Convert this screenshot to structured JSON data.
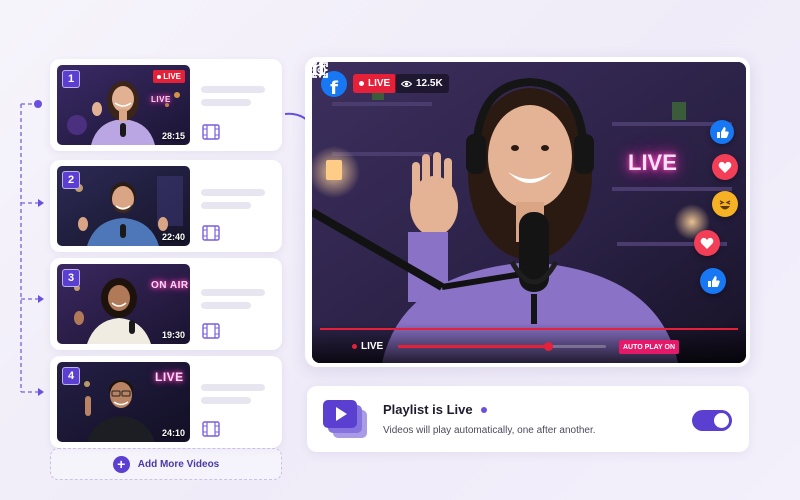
{
  "playlist": {
    "items": [
      {
        "number": "1",
        "duration": "28:15",
        "live_label": "LIVE",
        "sign": "LIVE",
        "is_live": true
      },
      {
        "number": "2",
        "duration": "22:40",
        "live_label": "",
        "sign": "",
        "is_live": false
      },
      {
        "number": "3",
        "duration": "19:30",
        "live_label": "",
        "sign": "ON AIR",
        "is_live": false
      },
      {
        "number": "4",
        "duration": "24:10",
        "live_label": "",
        "sign": "LIVE",
        "is_live": false
      }
    ],
    "add_more_label": "Add More Videos"
  },
  "player": {
    "platform_icon": "facebook-icon",
    "live_label": "LIVE",
    "viewer_count": "12.5K",
    "wall_sign": "LIVE",
    "controls": {
      "live_label": "LIVE",
      "autoplay_label": "AUTO PLAY ON",
      "progress": 0.72
    },
    "reactions": [
      "like-icon",
      "heart-icon",
      "haha-icon",
      "heart-icon",
      "like-icon"
    ]
  },
  "status": {
    "title": "Playlist is Live",
    "subtitle": "Videos will play automatically, one after another.",
    "toggle_on": true
  },
  "colors": {
    "accent": "#5b3fd0",
    "live_red": "#e5213a",
    "facebook_blue": "#1877f2",
    "neon_pink": "#ff3fb8"
  }
}
